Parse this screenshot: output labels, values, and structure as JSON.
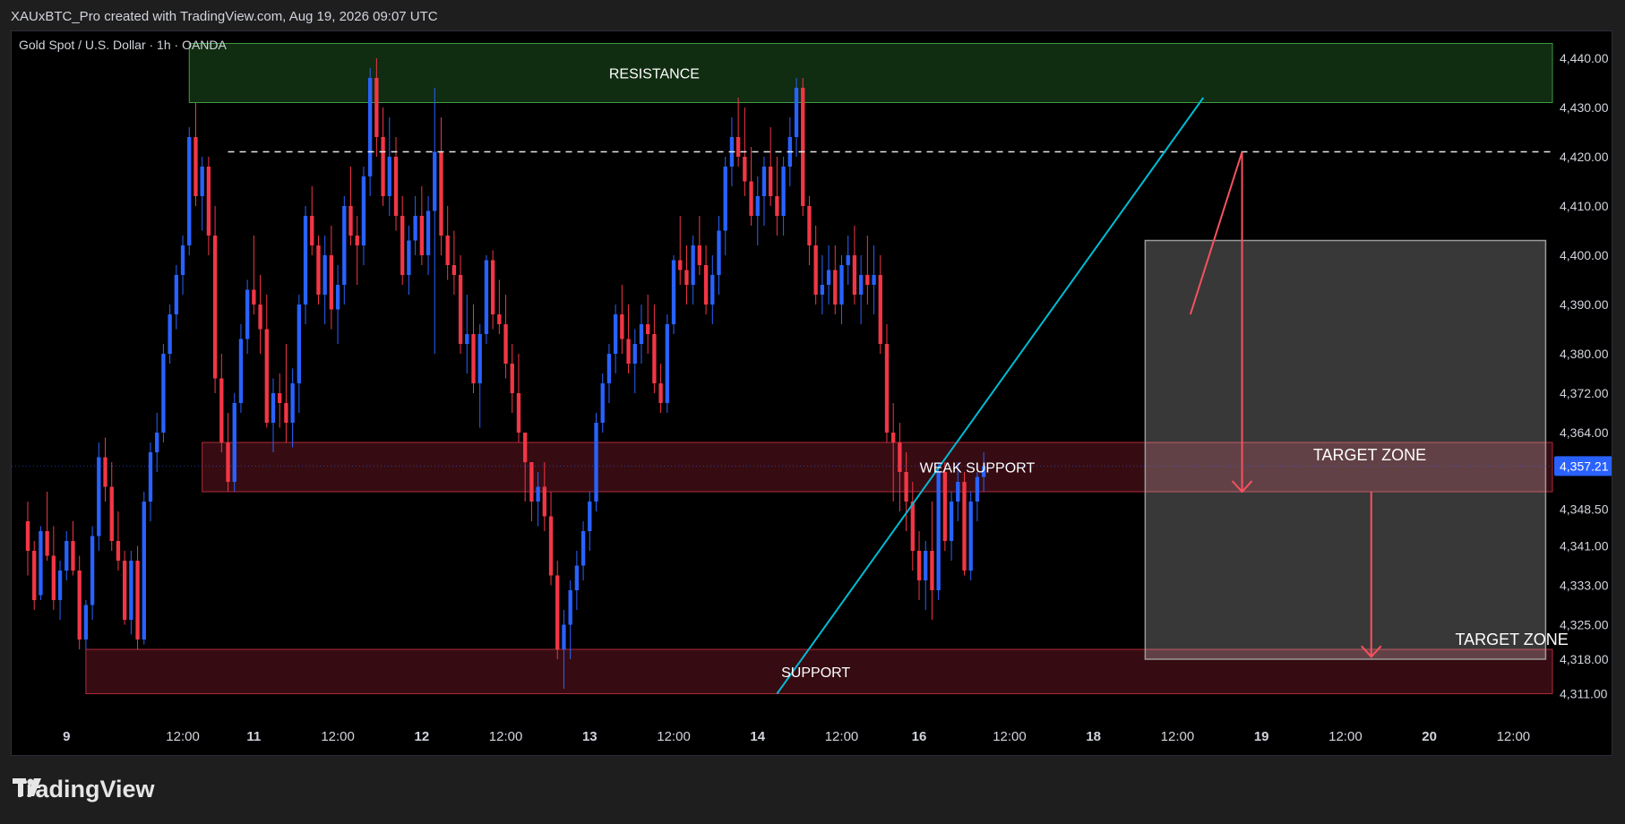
{
  "header": {
    "created_by": "XAUxBTC_Pro created with TradingView.com, Aug 19, 2026 09:07 UTC"
  },
  "brand": {
    "name": "TradingView"
  },
  "chart_data": {
    "type": "candlestick",
    "title": "Gold Spot / U.S. Dollar · 1h · OANDA",
    "symbol": "XAUUSD",
    "timeframe": "1h",
    "exchange": "OANDA",
    "last_price": 4357.21,
    "last_price_label": "4,357.21",
    "colors": {
      "up": "#2962ff",
      "down": "#f23645",
      "trendline": "#00bcd4",
      "resistance_zone": "#1b4d1f",
      "support_zone": "#5a1a22",
      "projection_box": "#555555",
      "arrow": "#f7525f"
    },
    "y_ticks": [
      {
        "v": 4440,
        "label": "4,440.00"
      },
      {
        "v": 4430,
        "label": "4,430.00"
      },
      {
        "v": 4420,
        "label": "4,420.00"
      },
      {
        "v": 4410,
        "label": "4,410.00"
      },
      {
        "v": 4400,
        "label": "4,400.00"
      },
      {
        "v": 4390,
        "label": "4,390.00"
      },
      {
        "v": 4380,
        "label": "4,380.00"
      },
      {
        "v": 4372,
        "label": "4,372.00"
      },
      {
        "v": 4364,
        "label": "4,364.00"
      },
      {
        "v": 4348.5,
        "label": "4,348.50"
      },
      {
        "v": 4341,
        "label": "4,341.00"
      },
      {
        "v": 4333,
        "label": "4,333.00"
      },
      {
        "v": 4325,
        "label": "4,325.00"
      },
      {
        "v": 4318,
        "label": "4,318.00"
      },
      {
        "v": 4311,
        "label": "4,311.00"
      }
    ],
    "x_ticks": [
      {
        "i": 6,
        "label": "9"
      },
      {
        "i": 24,
        "label": "12:00"
      },
      {
        "i": 35,
        "label": "11"
      },
      {
        "i": 48,
        "label": "12:00"
      },
      {
        "i": 61,
        "label": "12"
      },
      {
        "i": 74,
        "label": "12:00"
      },
      {
        "i": 87,
        "label": "13"
      },
      {
        "i": 100,
        "label": "12:00"
      },
      {
        "i": 113,
        "label": "14"
      },
      {
        "i": 126,
        "label": "12:00"
      },
      {
        "i": 138,
        "label": "16"
      },
      {
        "i": 152,
        "label": "12:00"
      },
      {
        "i": 165,
        "label": "18"
      },
      {
        "i": 178,
        "label": "12:00"
      },
      {
        "i": 191,
        "label": "19"
      },
      {
        "i": 204,
        "label": "12:00"
      },
      {
        "i": 217,
        "label": "20"
      },
      {
        "i": 230,
        "label": "12:00"
      }
    ],
    "y_range": [
      4308,
      4444
    ],
    "x_index_range": [
      0,
      233
    ],
    "zones": [
      {
        "label": "RESISTANCE",
        "lo": 4431,
        "hi": 4443,
        "i0": 25,
        "i1": 237
      },
      {
        "label": "WEAK SUPPORT",
        "lo": 4352,
        "hi": 4362,
        "i0": 27,
        "i1": 237
      },
      {
        "label": "SUPPORT",
        "lo": 4311,
        "hi": 4320,
        "i0": 9,
        "i1": 237
      }
    ],
    "key_level": {
      "v": 4421,
      "i0": 31,
      "i1": 237
    },
    "projection_box": {
      "lo": 4318,
      "hi": 4403,
      "i0": 173,
      "i1": 235
    },
    "trendline": {
      "i0": 116,
      "v0": 4311,
      "i1": 182,
      "v1": 4432
    },
    "annotations": [
      {
        "text": "TARGET ZONE",
        "i": 199,
        "v": 4359.5
      },
      {
        "text": "TARGET ZONE",
        "i": 221,
        "v": 4322
      }
    ],
    "path_arrows": [
      {
        "points": [
          [
            180,
            4388
          ],
          [
            188,
            4421
          ],
          [
            188,
            4352
          ]
        ]
      },
      {
        "points": [
          [
            208,
            4352
          ],
          [
            208,
            4318.5
          ]
        ]
      }
    ],
    "candles": [
      [
        4346,
        4350,
        4335,
        4340
      ],
      [
        4340,
        4342,
        4328,
        4330
      ],
      [
        4331,
        4345,
        4330,
        4344
      ],
      [
        4344,
        4352,
        4338,
        4339
      ],
      [
        4339,
        4345,
        4328,
        4330
      ],
      [
        4330,
        4338,
        4326,
        4336
      ],
      [
        4336,
        4344,
        4334,
        4342
      ],
      [
        4342,
        4346,
        4335,
        4336
      ],
      [
        4336,
        4339,
        4320,
        4322
      ],
      [
        4322,
        4330,
        4320,
        4329
      ],
      [
        4329,
        4345,
        4326,
        4343
      ],
      [
        4343,
        4362,
        4340,
        4359
      ],
      [
        4359,
        4363,
        4350,
        4353
      ],
      [
        4353,
        4358,
        4340,
        4342
      ],
      [
        4342,
        4348,
        4336,
        4338
      ],
      [
        4338,
        4340,
        4325,
        4326
      ],
      [
        4326,
        4340,
        4323,
        4338
      ],
      [
        4338,
        4341,
        4320,
        4322
      ],
      [
        4322,
        4352,
        4321,
        4350
      ],
      [
        4350,
        4362,
        4346,
        4360
      ],
      [
        4360,
        4368,
        4356,
        4364
      ],
      [
        4364,
        4382,
        4362,
        4380
      ],
      [
        4380,
        4390,
        4378,
        4388
      ],
      [
        4388,
        4398,
        4385,
        4396
      ],
      [
        4396,
        4404,
        4392,
        4402
      ],
      [
        4402,
        4426,
        4400,
        4424
      ],
      [
        4424,
        4431,
        4410,
        4412
      ],
      [
        4412,
        4420,
        4405,
        4418
      ],
      [
        4418,
        4420,
        4400,
        4404
      ],
      [
        4404,
        4410,
        4372,
        4375
      ],
      [
        4375,
        4380,
        4360,
        4362
      ],
      [
        4362,
        4368,
        4352,
        4354
      ],
      [
        4354,
        4372,
        4352,
        4370
      ],
      [
        4370,
        4386,
        4368,
        4383
      ],
      [
        4383,
        4395,
        4380,
        4393
      ],
      [
        4393,
        4404,
        4388,
        4390
      ],
      [
        4390,
        4396,
        4380,
        4385
      ],
      [
        4385,
        4392,
        4365,
        4366
      ],
      [
        4366,
        4375,
        4360,
        4372
      ],
      [
        4372,
        4376,
        4365,
        4370
      ],
      [
        4370,
        4382,
        4362,
        4366
      ],
      [
        4366,
        4377,
        4361,
        4374
      ],
      [
        4374,
        4392,
        4368,
        4390
      ],
      [
        4390,
        4410,
        4386,
        4408
      ],
      [
        4408,
        4414,
        4400,
        4402
      ],
      [
        4402,
        4404,
        4390,
        4392
      ],
      [
        4392,
        4404,
        4386,
        4400
      ],
      [
        4400,
        4406,
        4385,
        4389
      ],
      [
        4389,
        4398,
        4382,
        4394
      ],
      [
        4394,
        4412,
        4390,
        4410
      ],
      [
        4410,
        4418,
        4402,
        4404
      ],
      [
        4404,
        4408,
        4394,
        4402
      ],
      [
        4402,
        4418,
        4398,
        4416
      ],
      [
        4416,
        4438,
        4412,
        4436
      ],
      [
        4436,
        4440,
        4420,
        4424
      ],
      [
        4424,
        4430,
        4410,
        4412
      ],
      [
        4412,
        4428,
        4408,
        4420
      ],
      [
        4420,
        4424,
        4405,
        4408
      ],
      [
        4408,
        4412,
        4394,
        4396
      ],
      [
        4396,
        4406,
        4392,
        4403
      ],
      [
        4403,
        4412,
        4400,
        4408
      ],
      [
        4408,
        4414,
        4398,
        4400
      ],
      [
        4400,
        4412,
        4396,
        4409
      ],
      [
        4409,
        4434,
        4380,
        4421
      ],
      [
        4421,
        4428,
        4400,
        4404
      ],
      [
        4404,
        4410,
        4395,
        4398
      ],
      [
        4398,
        4405,
        4392,
        4396
      ],
      [
        4396,
        4400,
        4380,
        4382
      ],
      [
        4382,
        4392,
        4376,
        4384
      ],
      [
        4384,
        4390,
        4372,
        4374
      ],
      [
        4374,
        4386,
        4365,
        4384
      ],
      [
        4384,
        4400,
        4382,
        4399
      ],
      [
        4399,
        4401,
        4385,
        4388
      ],
      [
        4388,
        4395,
        4384,
        4386
      ],
      [
        4386,
        4392,
        4375,
        4378
      ],
      [
        4378,
        4382,
        4368,
        4372
      ],
      [
        4372,
        4380,
        4362,
        4364
      ],
      [
        4364,
        4360,
        4350,
        4358
      ],
      [
        4358,
        4356,
        4346,
        4350
      ],
      [
        4350,
        4356,
        4345,
        4353
      ],
      [
        4353,
        4358,
        4344,
        4347
      ],
      [
        4347,
        4352,
        4333,
        4335
      ],
      [
        4335,
        4338,
        4318,
        4320
      ],
      [
        4320,
        4328,
        4312,
        4325
      ],
      [
        4325,
        4334,
        4318,
        4332
      ],
      [
        4332,
        4340,
        4328,
        4337
      ],
      [
        4337,
        4346,
        4334,
        4344
      ],
      [
        4344,
        4352,
        4340,
        4350
      ],
      [
        4350,
        4368,
        4348,
        4366
      ],
      [
        4366,
        4376,
        4364,
        4374
      ],
      [
        4374,
        4382,
        4370,
        4380
      ],
      [
        4380,
        4390,
        4376,
        4388
      ],
      [
        4388,
        4394,
        4380,
        4383
      ],
      [
        4383,
        4390,
        4376,
        4378
      ],
      [
        4378,
        4385,
        4372,
        4382
      ],
      [
        4382,
        4390,
        4378,
        4386
      ],
      [
        4386,
        4392,
        4380,
        4384
      ],
      [
        4384,
        4390,
        4372,
        4374
      ],
      [
        4374,
        4378,
        4368,
        4370
      ],
      [
        4370,
        4388,
        4368,
        4386
      ],
      [
        4386,
        4400,
        4384,
        4399
      ],
      [
        4399,
        4408,
        4394,
        4397
      ],
      [
        4397,
        4402,
        4390,
        4394
      ],
      [
        4394,
        4404,
        4390,
        4402
      ],
      [
        4402,
        4408,
        4396,
        4398
      ],
      [
        4398,
        4402,
        4388,
        4390
      ],
      [
        4390,
        4400,
        4386,
        4396
      ],
      [
        4396,
        4408,
        4392,
        4405
      ],
      [
        4405,
        4420,
        4400,
        4418
      ],
      [
        4418,
        4428,
        4414,
        4424
      ],
      [
        4424,
        4432,
        4418,
        4420
      ],
      [
        4420,
        4430,
        4412,
        4415
      ],
      [
        4415,
        4422,
        4406,
        4408
      ],
      [
        4408,
        4416,
        4402,
        4412
      ],
      [
        4412,
        4420,
        4406,
        4418
      ],
      [
        4418,
        4426,
        4410,
        4412
      ],
      [
        4412,
        4420,
        4404,
        4408
      ],
      [
        4408,
        4420,
        4404,
        4418
      ],
      [
        4418,
        4428,
        4414,
        4424
      ],
      [
        4424,
        4436,
        4420,
        4434
      ],
      [
        4434,
        4436,
        4408,
        4410
      ],
      [
        4410,
        4412,
        4398,
        4402
      ],
      [
        4402,
        4406,
        4390,
        4392
      ],
      [
        4392,
        4400,
        4388,
        4394
      ],
      [
        4394,
        4402,
        4390,
        4397
      ],
      [
        4397,
        4402,
        4388,
        4390
      ],
      [
        4390,
        4400,
        4386,
        4398
      ],
      [
        4398,
        4404,
        4394,
        4400
      ],
      [
        4400,
        4406,
        4390,
        4392
      ],
      [
        4392,
        4400,
        4386,
        4396
      ],
      [
        4396,
        4404,
        4390,
        4394
      ],
      [
        4394,
        4402,
        4388,
        4396
      ],
      [
        4396,
        4400,
        4380,
        4382
      ],
      [
        4382,
        4386,
        4362,
        4364
      ],
      [
        4364,
        4370,
        4350,
        4362
      ],
      [
        4362,
        4366,
        4348,
        4356
      ],
      [
        4356,
        4360,
        4344,
        4350
      ],
      [
        4350,
        4354,
        4336,
        4340
      ],
      [
        4340,
        4344,
        4330,
        4334
      ],
      [
        4334,
        4342,
        4328,
        4340
      ],
      [
        4340,
        4350,
        4326,
        4332
      ],
      [
        4332,
        4358,
        4330,
        4356
      ],
      [
        4356,
        4358,
        4340,
        4342
      ],
      [
        4342,
        4352,
        4338,
        4350
      ],
      [
        4350,
        4358,
        4346,
        4354
      ],
      [
        4354,
        4356,
        4335,
        4336
      ],
      [
        4336,
        4352,
        4334,
        4350
      ],
      [
        4350,
        4356,
        4346,
        4355
      ],
      [
        4355,
        4360,
        4352,
        4357.21
      ]
    ]
  }
}
